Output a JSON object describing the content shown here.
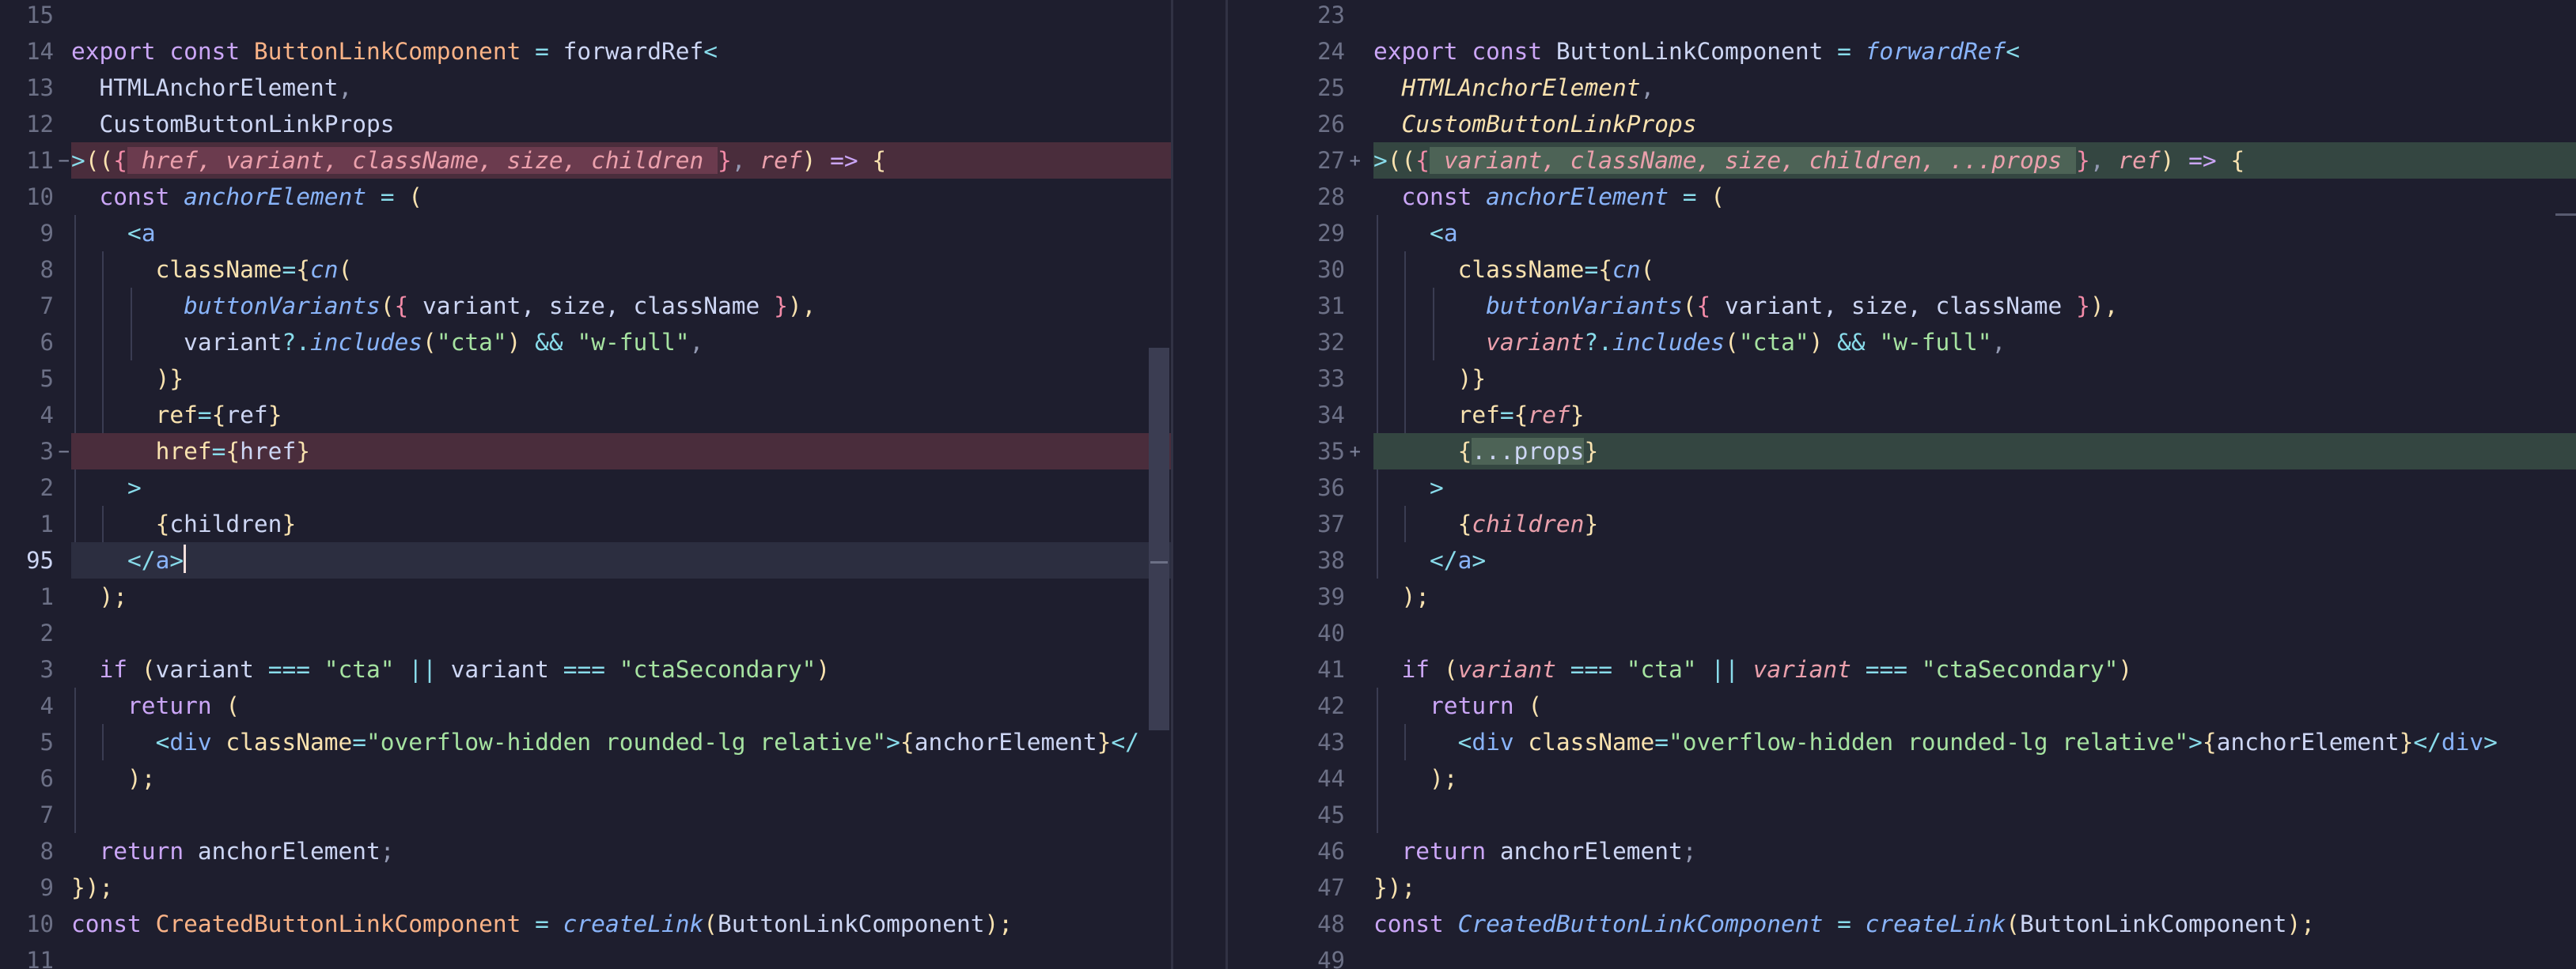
{
  "editor": {
    "cursor_line_label": "95"
  },
  "left_pane": {
    "lines": [
      {
        "n": "15",
        "tokens": []
      },
      {
        "n": "14",
        "tokens": [
          {
            "t": "export const ",
            "c": "kw"
          },
          {
            "t": "ButtonLinkComponent",
            "c": "org"
          },
          {
            "t": " = ",
            "c": "op"
          },
          {
            "t": "forwardRef",
            "c": "pl"
          },
          {
            "t": "<",
            "c": "op"
          }
        ]
      },
      {
        "n": "13",
        "indent": 1,
        "tokens": [
          {
            "t": "HTMLAnchorElement",
            "c": "pl"
          },
          {
            "t": ",",
            "c": "pu"
          }
        ]
      },
      {
        "n": "12",
        "indent": 1,
        "tokens": [
          {
            "t": "CustomButtonLinkProps",
            "c": "pl"
          }
        ]
      },
      {
        "n": "11",
        "mark": "−",
        "bg": "del",
        "tokens": [
          {
            "t": ">",
            "c": "op"
          },
          {
            "t": "((",
            "c": "br"
          },
          {
            "t": "{",
            "c": "br2"
          },
          {
            "t": " href, variant, className, size, children ",
            "c": "pr",
            "hl": "del"
          },
          {
            "t": "}",
            "c": "br2"
          },
          {
            "t": ", ",
            "c": "pu"
          },
          {
            "t": "ref",
            "c": "pr"
          },
          {
            "t": ")",
            "c": "br"
          },
          {
            "t": " => ",
            "c": "kw"
          },
          {
            "t": "{",
            "c": "br"
          }
        ]
      },
      {
        "n": "10",
        "indent": 1,
        "tokens": [
          {
            "t": "const ",
            "c": "kw"
          },
          {
            "t": "anchorElement",
            "c": "fn"
          },
          {
            "t": " = ",
            "c": "op"
          },
          {
            "t": "(",
            "c": "br"
          }
        ]
      },
      {
        "n": "9",
        "indent": 2,
        "tokens": [
          {
            "t": "<",
            "c": "op"
          },
          {
            "t": "a",
            "c": "tag"
          }
        ]
      },
      {
        "n": "8",
        "indent": 3,
        "tokens": [
          {
            "t": "className",
            "c": "at"
          },
          {
            "t": "=",
            "c": "op"
          },
          {
            "t": "{",
            "c": "br"
          },
          {
            "t": "cn",
            "c": "fn"
          },
          {
            "t": "(",
            "c": "br"
          }
        ]
      },
      {
        "n": "7",
        "indent": 4,
        "tokens": [
          {
            "t": "buttonVariants",
            "c": "fn"
          },
          {
            "t": "(",
            "c": "br"
          },
          {
            "t": "{",
            "c": "br2"
          },
          {
            "t": " variant, size, className ",
            "c": "pl"
          },
          {
            "t": "}",
            "c": "br2"
          },
          {
            "t": "),",
            "c": "br"
          }
        ]
      },
      {
        "n": "6",
        "indent": 4,
        "tokens": [
          {
            "t": "variant",
            "c": "pl"
          },
          {
            "t": "?.",
            "c": "op"
          },
          {
            "t": "includes",
            "c": "fn"
          },
          {
            "t": "(",
            "c": "br"
          },
          {
            "t": "\"cta\"",
            "c": "str"
          },
          {
            "t": ")",
            "c": "br"
          },
          {
            "t": " && ",
            "c": "op"
          },
          {
            "t": "\"w-full\"",
            "c": "str"
          },
          {
            "t": ",",
            "c": "pu"
          }
        ]
      },
      {
        "n": "5",
        "indent": 3,
        "tokens": [
          {
            "t": ")}",
            "c": "br"
          }
        ]
      },
      {
        "n": "4",
        "indent": 3,
        "tokens": [
          {
            "t": "ref",
            "c": "at"
          },
          {
            "t": "=",
            "c": "op"
          },
          {
            "t": "{",
            "c": "br"
          },
          {
            "t": "ref",
            "c": "pl"
          },
          {
            "t": "}",
            "c": "br"
          }
        ]
      },
      {
        "n": "3",
        "mark": "−",
        "bg": "del",
        "indent": 3,
        "tokens": [
          {
            "t": "href",
            "c": "at"
          },
          {
            "t": "=",
            "c": "op"
          },
          {
            "t": "{",
            "c": "br"
          },
          {
            "t": "href",
            "c": "pl"
          },
          {
            "t": "}",
            "c": "br"
          }
        ]
      },
      {
        "n": "2",
        "indent": 2,
        "tokens": [
          {
            "t": ">",
            "c": "op"
          }
        ]
      },
      {
        "n": "1",
        "indent": 3,
        "tokens": [
          {
            "t": "{",
            "c": "br"
          },
          {
            "t": "children",
            "c": "pl"
          },
          {
            "t": "}",
            "c": "br"
          }
        ]
      },
      {
        "n": "95",
        "cur": true,
        "bg": "cur",
        "indent": 2,
        "tokens": [
          {
            "t": "</",
            "c": "op"
          },
          {
            "t": "a",
            "c": "tag"
          },
          {
            "t": ">",
            "c": "op"
          }
        ]
      },
      {
        "n": "1",
        "indent": 1,
        "tokens": [
          {
            "t": ");",
            "c": "br"
          }
        ]
      },
      {
        "n": "2",
        "tokens": []
      },
      {
        "n": "3",
        "indent": 1,
        "tokens": [
          {
            "t": "if ",
            "c": "kw"
          },
          {
            "t": "(",
            "c": "br"
          },
          {
            "t": "variant ",
            "c": "pl"
          },
          {
            "t": "=== ",
            "c": "op"
          },
          {
            "t": "\"cta\" ",
            "c": "str"
          },
          {
            "t": "|| ",
            "c": "op"
          },
          {
            "t": "variant ",
            "c": "pl"
          },
          {
            "t": "=== ",
            "c": "op"
          },
          {
            "t": "\"ctaSecondary\"",
            "c": "str"
          },
          {
            "t": ")",
            "c": "br"
          }
        ]
      },
      {
        "n": "4",
        "indent": 2,
        "tokens": [
          {
            "t": "return ",
            "c": "kw"
          },
          {
            "t": "(",
            "c": "br"
          }
        ]
      },
      {
        "n": "5",
        "indent": 3,
        "tokens": [
          {
            "t": "<",
            "c": "op"
          },
          {
            "t": "div ",
            "c": "tag"
          },
          {
            "t": "className",
            "c": "at"
          },
          {
            "t": "=",
            "c": "op"
          },
          {
            "t": "\"overflow-hidden rounded-lg relative\"",
            "c": "str"
          },
          {
            "t": ">",
            "c": "op"
          },
          {
            "t": "{",
            "c": "br"
          },
          {
            "t": "anchorElement",
            "c": "pl"
          },
          {
            "t": "}",
            "c": "br"
          },
          {
            "t": "</",
            "c": "op"
          }
        ]
      },
      {
        "n": "6",
        "indent": 2,
        "tokens": [
          {
            "t": ");",
            "c": "br"
          }
        ]
      },
      {
        "n": "7",
        "tokens": []
      },
      {
        "n": "8",
        "indent": 1,
        "tokens": [
          {
            "t": "return ",
            "c": "kw"
          },
          {
            "t": "anchorElement",
            "c": "pl"
          },
          {
            "t": ";",
            "c": "pu"
          }
        ]
      },
      {
        "n": "9",
        "tokens": [
          {
            "t": "}",
            "c": "br"
          },
          {
            "t": ");",
            "c": "br"
          }
        ]
      },
      {
        "n": "10",
        "tokens": [
          {
            "t": "const ",
            "c": "kw"
          },
          {
            "t": "CreatedButtonLinkComponent",
            "c": "org"
          },
          {
            "t": " = ",
            "c": "op"
          },
          {
            "t": "createLink",
            "c": "fn"
          },
          {
            "t": "(",
            "c": "br"
          },
          {
            "t": "ButtonLinkComponent",
            "c": "pl"
          },
          {
            "t": ");",
            "c": "br"
          }
        ]
      },
      {
        "n": "11",
        "tokens": []
      }
    ]
  },
  "right_pane": {
    "lines": [
      {
        "n": "23",
        "tokens": []
      },
      {
        "n": "24",
        "tokens": [
          {
            "t": "export const ",
            "c": "kw"
          },
          {
            "t": "ButtonLinkComponent",
            "c": "pl"
          },
          {
            "t": " = ",
            "c": "op"
          },
          {
            "t": "forwardRef",
            "c": "fn"
          },
          {
            "t": "<",
            "c": "op"
          }
        ]
      },
      {
        "n": "25",
        "indent": 1,
        "tokens": [
          {
            "t": "HTMLAnchorElement",
            "c": "typ"
          },
          {
            "t": ",",
            "c": "pu"
          }
        ]
      },
      {
        "n": "26",
        "indent": 1,
        "tokens": [
          {
            "t": "CustomButtonLinkProps",
            "c": "typ"
          }
        ]
      },
      {
        "n": "27",
        "mark": "+",
        "bg": "add",
        "tokens": [
          {
            "t": ">",
            "c": "op"
          },
          {
            "t": "((",
            "c": "br"
          },
          {
            "t": "{",
            "c": "br2"
          },
          {
            "t": " variant, className, size, children, ...props ",
            "c": "pr",
            "hl": "add"
          },
          {
            "t": "}",
            "c": "br2"
          },
          {
            "t": ", ",
            "c": "pu"
          },
          {
            "t": "ref",
            "c": "pr"
          },
          {
            "t": ")",
            "c": "br"
          },
          {
            "t": " => ",
            "c": "kw"
          },
          {
            "t": "{",
            "c": "br"
          }
        ]
      },
      {
        "n": "28",
        "indent": 1,
        "tokens": [
          {
            "t": "const ",
            "c": "kw"
          },
          {
            "t": "anchorElement",
            "c": "fn"
          },
          {
            "t": " = ",
            "c": "op"
          },
          {
            "t": "(",
            "c": "br"
          }
        ]
      },
      {
        "n": "29",
        "indent": 2,
        "tokens": [
          {
            "t": "<",
            "c": "op"
          },
          {
            "t": "a",
            "c": "tag"
          }
        ]
      },
      {
        "n": "30",
        "indent": 3,
        "tokens": [
          {
            "t": "className",
            "c": "at"
          },
          {
            "t": "=",
            "c": "op"
          },
          {
            "t": "{",
            "c": "br"
          },
          {
            "t": "cn",
            "c": "fn"
          },
          {
            "t": "(",
            "c": "br"
          }
        ]
      },
      {
        "n": "31",
        "indent": 4,
        "tokens": [
          {
            "t": "buttonVariants",
            "c": "fn"
          },
          {
            "t": "(",
            "c": "br"
          },
          {
            "t": "{",
            "c": "br2"
          },
          {
            "t": " variant, size, className ",
            "c": "pl"
          },
          {
            "t": "}",
            "c": "br2"
          },
          {
            "t": "),",
            "c": "br"
          }
        ]
      },
      {
        "n": "32",
        "indent": 4,
        "tokens": [
          {
            "t": "variant",
            "c": "pr"
          },
          {
            "t": "?.",
            "c": "op"
          },
          {
            "t": "includes",
            "c": "fn"
          },
          {
            "t": "(",
            "c": "br"
          },
          {
            "t": "\"cta\"",
            "c": "str"
          },
          {
            "t": ")",
            "c": "br"
          },
          {
            "t": " && ",
            "c": "op"
          },
          {
            "t": "\"w-full\"",
            "c": "str"
          },
          {
            "t": ",",
            "c": "pu"
          }
        ]
      },
      {
        "n": "33",
        "indent": 3,
        "tokens": [
          {
            "t": ")}",
            "c": "br"
          }
        ]
      },
      {
        "n": "34",
        "indent": 3,
        "tokens": [
          {
            "t": "ref",
            "c": "at"
          },
          {
            "t": "=",
            "c": "op"
          },
          {
            "t": "{",
            "c": "br"
          },
          {
            "t": "ref",
            "c": "pr"
          },
          {
            "t": "}",
            "c": "br"
          }
        ]
      },
      {
        "n": "35",
        "mark": "+",
        "bg": "add",
        "indent": 3,
        "tokens": [
          {
            "t": "{",
            "c": "br"
          },
          {
            "t": "...props",
            "c": "pl",
            "hl": "add"
          },
          {
            "t": "}",
            "c": "br"
          }
        ]
      },
      {
        "n": "36",
        "indent": 2,
        "tokens": [
          {
            "t": ">",
            "c": "op"
          }
        ]
      },
      {
        "n": "37",
        "indent": 3,
        "tokens": [
          {
            "t": "{",
            "c": "br"
          },
          {
            "t": "children",
            "c": "pr"
          },
          {
            "t": "}",
            "c": "br"
          }
        ]
      },
      {
        "n": "38",
        "indent": 2,
        "tokens": [
          {
            "t": "</",
            "c": "op"
          },
          {
            "t": "a",
            "c": "tag"
          },
          {
            "t": ">",
            "c": "op"
          }
        ]
      },
      {
        "n": "39",
        "indent": 1,
        "tokens": [
          {
            "t": ");",
            "c": "br"
          }
        ]
      },
      {
        "n": "40",
        "tokens": []
      },
      {
        "n": "41",
        "indent": 1,
        "tokens": [
          {
            "t": "if ",
            "c": "kw"
          },
          {
            "t": "(",
            "c": "br"
          },
          {
            "t": "variant ",
            "c": "pr"
          },
          {
            "t": "=== ",
            "c": "op"
          },
          {
            "t": "\"cta\" ",
            "c": "str"
          },
          {
            "t": "|| ",
            "c": "op"
          },
          {
            "t": "variant ",
            "c": "pr"
          },
          {
            "t": "=== ",
            "c": "op"
          },
          {
            "t": "\"ctaSecondary\"",
            "c": "str"
          },
          {
            "t": ")",
            "c": "br"
          }
        ]
      },
      {
        "n": "42",
        "indent": 2,
        "tokens": [
          {
            "t": "return ",
            "c": "kw"
          },
          {
            "t": "(",
            "c": "br"
          }
        ]
      },
      {
        "n": "43",
        "indent": 3,
        "tokens": [
          {
            "t": "<",
            "c": "op"
          },
          {
            "t": "div ",
            "c": "tag"
          },
          {
            "t": "className",
            "c": "at"
          },
          {
            "t": "=",
            "c": "op"
          },
          {
            "t": "\"overflow-hidden rounded-lg relative\"",
            "c": "str"
          },
          {
            "t": ">",
            "c": "op"
          },
          {
            "t": "{",
            "c": "br"
          },
          {
            "t": "anchorElement",
            "c": "pl"
          },
          {
            "t": "}",
            "c": "br"
          },
          {
            "t": "</",
            "c": "op"
          },
          {
            "t": "div",
            "c": "tag"
          },
          {
            "t": ">",
            "c": "op"
          }
        ]
      },
      {
        "n": "44",
        "indent": 2,
        "tokens": [
          {
            "t": ");",
            "c": "br"
          }
        ]
      },
      {
        "n": "45",
        "tokens": []
      },
      {
        "n": "46",
        "indent": 1,
        "tokens": [
          {
            "t": "return ",
            "c": "kw"
          },
          {
            "t": "anchorElement",
            "c": "pl"
          },
          {
            "t": ";",
            "c": "pu"
          }
        ]
      },
      {
        "n": "47",
        "tokens": [
          {
            "t": "}",
            "c": "br"
          },
          {
            "t": ");",
            "c": "br"
          }
        ]
      },
      {
        "n": "48",
        "tokens": [
          {
            "t": "const ",
            "c": "kw"
          },
          {
            "t": "CreatedButtonLinkComponent",
            "c": "fn"
          },
          {
            "t": " = ",
            "c": "op"
          },
          {
            "t": "createLink",
            "c": "fn"
          },
          {
            "t": "(",
            "c": "br"
          },
          {
            "t": "ButtonLinkComponent",
            "c": "pl"
          },
          {
            "t": ");",
            "c": "br"
          }
        ]
      },
      {
        "n": "49",
        "tokens": []
      }
    ]
  },
  "theme": {
    "background": "#1e1e2e",
    "deleted_line": "#4a2d3c",
    "added_line": "#344641",
    "current_line": "#2c2e40"
  }
}
